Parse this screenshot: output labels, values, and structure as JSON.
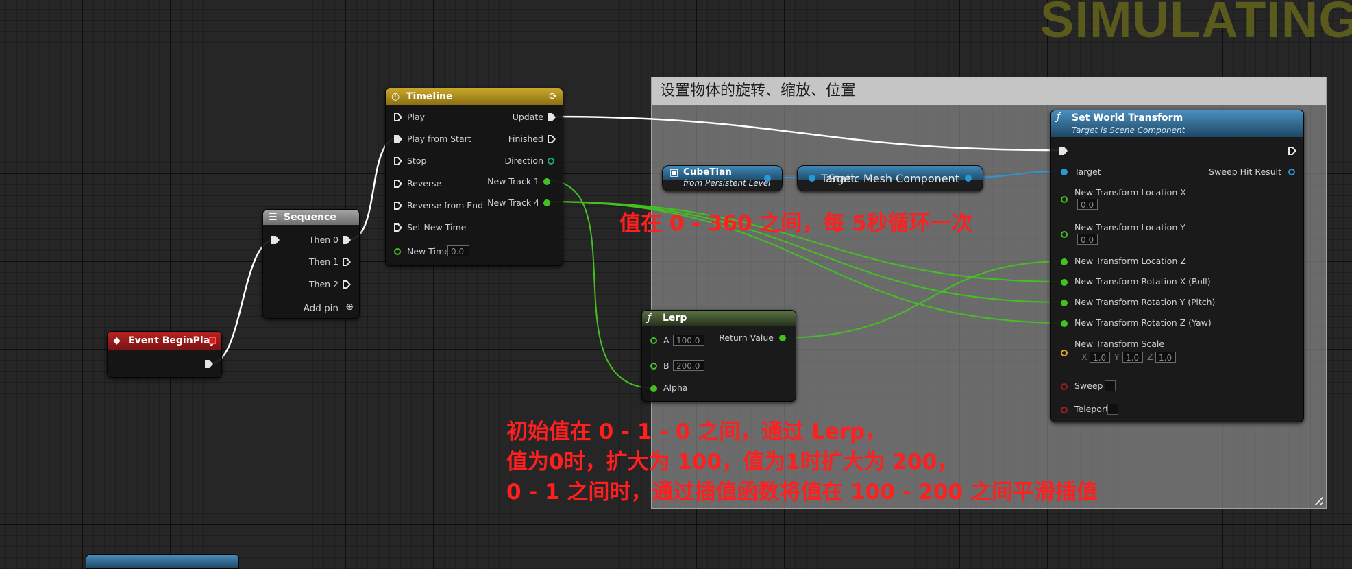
{
  "banner": "SIMULATING",
  "comment": {
    "title": "设置物体的旋转、缩放、位置"
  },
  "colors": {
    "timeline_header": "#b39420",
    "sequence_header": "#8d8d8d",
    "event_header": "#9e1c1c",
    "function_header": "#3a7da8",
    "lerp_header": "#4a5e36",
    "exec_wire": "#ffffff",
    "float_wire": "#43c21f",
    "object_wire": "#2a96d6",
    "annotation": "#ff1f1f"
  },
  "timeline": {
    "title": "Timeline",
    "inputs": [
      "Play",
      "Play from Start",
      "Stop",
      "Reverse",
      "Reverse from End",
      "Set New Time",
      "New Time"
    ],
    "new_time_value": "0.0",
    "outputs": [
      "Update",
      "Finished",
      "Direction",
      "New Track 1",
      "New Track 4"
    ]
  },
  "sequence": {
    "title": "Sequence",
    "outputs": [
      "Then 0",
      "Then 1",
      "Then 2"
    ],
    "add_pin": "Add pin"
  },
  "event": {
    "title": "Event BeginPlay"
  },
  "cube": {
    "name": "CubeTian",
    "sub": "from Persistent Level"
  },
  "mesh": {
    "target": "Target",
    "output": "Static Mesh Component"
  },
  "lerp": {
    "title": "Lerp",
    "a_label": "A",
    "a_value": "100.0",
    "b_label": "B",
    "b_value": "200.0",
    "alpha": "Alpha",
    "ret": "Return Value"
  },
  "swt": {
    "title": "Set World Transform",
    "subtitle": "Target is Scene Component",
    "target": "Target",
    "sweep_hit": "Sweep Hit Result",
    "loc_x": "New Transform Location X",
    "loc_x_value": "0.0",
    "loc_y": "New Transform Location Y",
    "loc_y_value": "0.0",
    "loc_z": "New Transform Location Z",
    "rot_x": "New Transform Rotation X (Roll)",
    "rot_y": "New Transform Rotation Y (Pitch)",
    "rot_z": "New Transform Rotation Z (Yaw)",
    "scale": "New Transform Scale",
    "scale_x_label": "X",
    "scale_x": "1.0",
    "scale_y_label": "Y",
    "scale_y": "1.0",
    "scale_z_label": "Z",
    "scale_z": "1.0",
    "sweep": "Sweep",
    "teleport": "Teleport"
  },
  "annotations": {
    "range": "值在 0 - 360 之间，每 5秒循环一次",
    "line1": "初始值在 0 - 1 - 0 之间，通过 Lerp，",
    "line2": "值为0时，扩大为 100，值为1时扩大为 200，",
    "line3": "0 - 1 之间时，通过插值函数将值在  100 - 200 之间平滑插值"
  },
  "icons": {
    "timeline": "clock-icon",
    "loop": "loop-icon",
    "sequence": "sequence-icon",
    "event": "event-diamond-icon",
    "function": "function-icon",
    "actor": "cube-actor-icon"
  }
}
